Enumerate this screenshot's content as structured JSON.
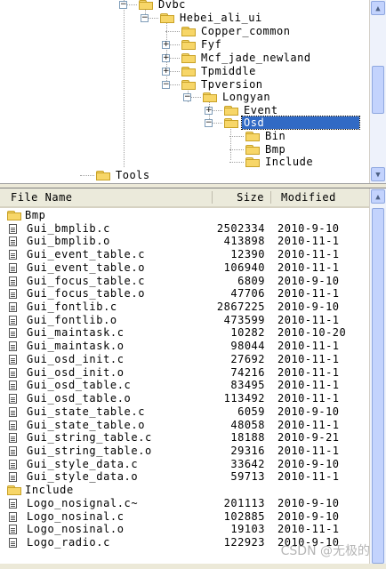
{
  "tree": {
    "nodes": [
      {
        "label": "Dvbc",
        "expander": "-",
        "selected": false
      },
      {
        "label": "Hebei_ali_ui",
        "expander": "-",
        "selected": false
      },
      {
        "label": "Copper_common",
        "expander": "",
        "selected": false
      },
      {
        "label": "Fyf",
        "expander": "+",
        "selected": false
      },
      {
        "label": "Mcf_jade_newland",
        "expander": "+",
        "selected": false
      },
      {
        "label": "Tpmiddle",
        "expander": "+",
        "selected": false
      },
      {
        "label": "Tpversion",
        "expander": "-",
        "selected": false
      },
      {
        "label": "Longyan",
        "expander": "-",
        "selected": false
      },
      {
        "label": "Event",
        "expander": "+",
        "selected": false
      },
      {
        "label": "Osd",
        "expander": "-",
        "selected": true
      },
      {
        "label": "Bin",
        "expander": "",
        "selected": false
      },
      {
        "label": "Bmp",
        "expander": "",
        "selected": false
      },
      {
        "label": "Include",
        "expander": "",
        "selected": false
      },
      {
        "label": "Tools",
        "expander": "",
        "selected": false
      }
    ]
  },
  "list": {
    "columns": {
      "name": "File Name",
      "size": "Size",
      "modified": "Modified"
    },
    "rows": [
      {
        "type": "folder",
        "name": "Bmp",
        "size": "",
        "modified": ""
      },
      {
        "type": "file",
        "name": "Gui_bmplib.c",
        "size": "2502334",
        "modified": "2010-9-10"
      },
      {
        "type": "file",
        "name": "Gui_bmplib.o",
        "size": "413898",
        "modified": "2010-11-1"
      },
      {
        "type": "file",
        "name": "Gui_event_table.c",
        "size": "12390",
        "modified": "2010-11-1"
      },
      {
        "type": "file",
        "name": "Gui_event_table.o",
        "size": "106940",
        "modified": "2010-11-1"
      },
      {
        "type": "file",
        "name": "Gui_focus_table.c",
        "size": "6809",
        "modified": "2010-9-10"
      },
      {
        "type": "file",
        "name": "Gui_focus_table.o",
        "size": "47706",
        "modified": "2010-11-1"
      },
      {
        "type": "file",
        "name": "Gui_fontlib.c",
        "size": "2867225",
        "modified": "2010-9-10"
      },
      {
        "type": "file",
        "name": "Gui_fontlib.o",
        "size": "473599",
        "modified": "2010-11-1"
      },
      {
        "type": "file",
        "name": "Gui_maintask.c",
        "size": "10282",
        "modified": "2010-10-20"
      },
      {
        "type": "file",
        "name": "Gui_maintask.o",
        "size": "98044",
        "modified": "2010-11-1"
      },
      {
        "type": "file",
        "name": "Gui_osd_init.c",
        "size": "27692",
        "modified": "2010-11-1"
      },
      {
        "type": "file",
        "name": "Gui_osd_init.o",
        "size": "74216",
        "modified": "2010-11-1"
      },
      {
        "type": "file",
        "name": "Gui_osd_table.c",
        "size": "83495",
        "modified": "2010-11-1"
      },
      {
        "type": "file",
        "name": "Gui_osd_table.o",
        "size": "113492",
        "modified": "2010-11-1"
      },
      {
        "type": "file",
        "name": "Gui_state_table.c",
        "size": "6059",
        "modified": "2010-9-10"
      },
      {
        "type": "file",
        "name": "Gui_state_table.o",
        "size": "48058",
        "modified": "2010-11-1"
      },
      {
        "type": "file",
        "name": "Gui_string_table.c",
        "size": "18188",
        "modified": "2010-9-21"
      },
      {
        "type": "file",
        "name": "Gui_string_table.o",
        "size": "29316",
        "modified": "2010-11-1"
      },
      {
        "type": "file",
        "name": "Gui_style_data.c",
        "size": "33642",
        "modified": "2010-9-10"
      },
      {
        "type": "file",
        "name": "Gui_style_data.o",
        "size": "59713",
        "modified": "2010-11-1"
      },
      {
        "type": "folder",
        "name": "Include",
        "size": "",
        "modified": ""
      },
      {
        "type": "file",
        "name": "Logo_nosignal.c~",
        "size": "201113",
        "modified": "2010-9-10"
      },
      {
        "type": "file",
        "name": "Logo_nosinal.c",
        "size": "102885",
        "modified": "2010-9-10"
      },
      {
        "type": "file",
        "name": "Logo_nosinal.o",
        "size": "19103",
        "modified": "2010-11-1"
      },
      {
        "type": "file",
        "name": "Logo_radio.c",
        "size": "122923",
        "modified": "2010-9-10"
      }
    ]
  },
  "watermark": "CSDN @无极的",
  "colors": {
    "selection": "#316ac5",
    "folder": "#f7d668",
    "pane_bg": "#ffffff",
    "chrome": "#ece9d8"
  }
}
